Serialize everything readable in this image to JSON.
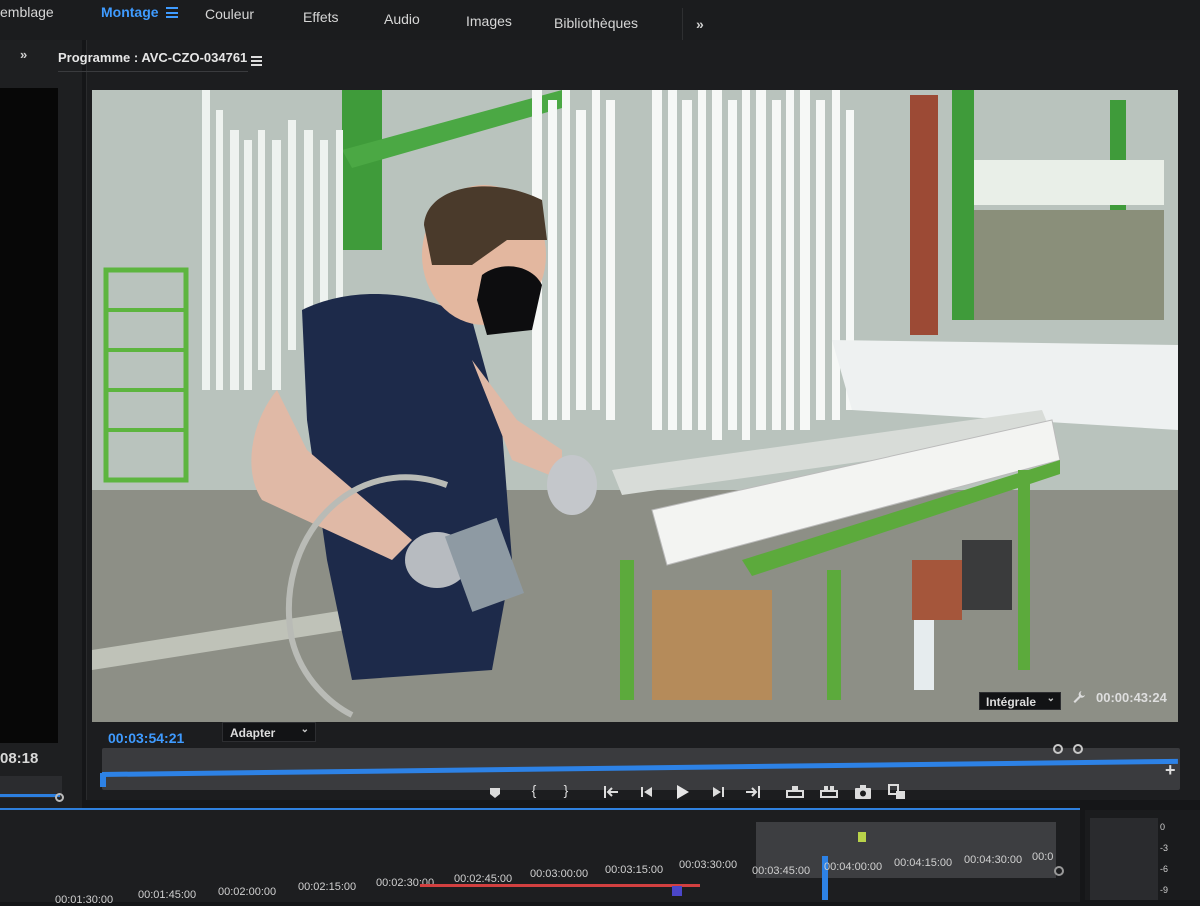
{
  "workspaces": [
    {
      "label": "emblage",
      "active": false
    },
    {
      "label": "Montage",
      "active": true
    },
    {
      "label": "Couleur",
      "active": false
    },
    {
      "label": "Effets",
      "active": false
    },
    {
      "label": "Audio",
      "active": false
    },
    {
      "label": "Images",
      "active": false
    },
    {
      "label": "Bibliothèques",
      "active": false
    }
  ],
  "source": {
    "timecode": "08:18"
  },
  "program": {
    "title": "Programme : AVC-CZO-034761",
    "current_timecode": "00:03:54:21",
    "fit_option": "Adapter",
    "quality_option": "Intégrale",
    "duration_timecode": "00:00:43:24",
    "playhead_fraction": 0.0
  },
  "timeline": {
    "ruler_row1": [
      "00:03:45:00",
      "00:04:00:00",
      "00:04:15:00",
      "00:04:30:00",
      "00:0"
    ],
    "ruler_row2": [
      "00:01:30:00",
      "00:01:45:00",
      "00:02:00:00",
      "00:02:15:00",
      "00:02:30:00",
      "00:02:45:00",
      "00:03:00:00",
      "00:03:15:00",
      "00:03:30:00",
      "00:03:45:00",
      "00:04:00:00",
      "00:04:15:00"
    ]
  },
  "audio_meter": {
    "labels": [
      "0",
      "-3",
      "-6",
      "-9"
    ]
  },
  "icons": {
    "workspace_menu": "hamburger-icon",
    "more_workspaces": "double-chevron-right-icon",
    "panel_menu": "hamburger-icon",
    "settings": "wrench-icon",
    "add_button": "plus-icon"
  },
  "colors": {
    "accent": "#3f9bff",
    "playhead": "#2d82e6",
    "work_area": "#d24040"
  }
}
